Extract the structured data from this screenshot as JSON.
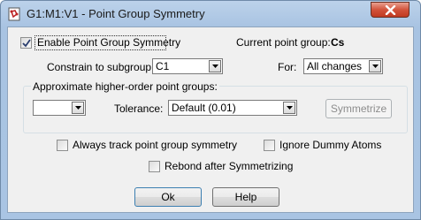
{
  "window": {
    "title": "G1:M1:V1 - Point Group Symmetry"
  },
  "enable_symmetry": {
    "label": "Enable Point Group Symmetry",
    "checked": true
  },
  "current_point_group": {
    "label": "Current point group:",
    "value": "Cs"
  },
  "constrain": {
    "label": "Constrain to subgroup:",
    "value": "C1"
  },
  "for_field": {
    "label": "For:",
    "value": "All changes"
  },
  "approx": {
    "label": "Approximate higher-order point groups:",
    "group_value": "",
    "tolerance_label": "Tolerance:",
    "tolerance_value": "Default (0.01)",
    "symmetrize_label": "Symmetrize"
  },
  "options": {
    "always_track": {
      "label": "Always track point group symmetry",
      "checked": false
    },
    "ignore_dummy": {
      "label": "Ignore Dummy Atoms",
      "checked": false
    },
    "rebond": {
      "label": "Rebond after Symmetrizing",
      "checked": false
    }
  },
  "buttons": {
    "ok": "Ok",
    "help": "Help"
  },
  "colors": {
    "title_bar": "#a9c4e3",
    "close": "#c03a21",
    "client": "#f0f0f0"
  }
}
